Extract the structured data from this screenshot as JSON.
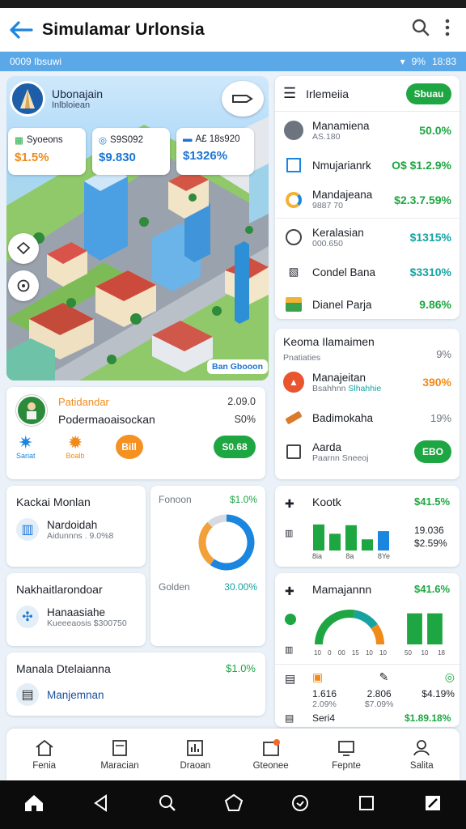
{
  "app_bar": {
    "title": "Simulamar Urlonsia"
  },
  "status_bar": {
    "left": "0009 Ibsuwi",
    "battery": "9%",
    "time": "18:83"
  },
  "map_panel": {
    "header_title": "Ubonajain",
    "header_subtitle": "Inlbloiean",
    "chips": [
      {
        "label": "Syoeons",
        "value": "$1.5%",
        "value_color": "#f08a19"
      },
      {
        "label": "S9S092",
        "value": "$9.830",
        "value_color": "#1a74d6"
      },
      {
        "label": "A£ 18s920",
        "value": "$1326%",
        "value_color": "#1a74d6"
      }
    ],
    "badge": "Ban Gbooon"
  },
  "right_list_top": {
    "title": "Irlemeiia",
    "action": "Sbuau",
    "rows": [
      {
        "label": "Manamiena",
        "sub": "AS.180",
        "value": "50.0%",
        "value_color": "#1ea642",
        "icon": "avatar-icon"
      },
      {
        "label": "Nmujarianrk",
        "sub": "",
        "value": "O$ $1.2.9%",
        "value_color": "#1ea642",
        "icon": "building-icon"
      },
      {
        "label": "Mandajeana",
        "sub": "9887 70",
        "value": "$2.3.7.59%",
        "value_color": "#1ea642",
        "icon": "chart-icon"
      }
    ]
  },
  "right_list_mid": {
    "rows": [
      {
        "label": "Keralasian",
        "sub": "000.650",
        "value": "$1315%",
        "value_color": "#14a3a3",
        "icon": "circle-icon"
      },
      {
        "label": "Condel Bana",
        "sub": "",
        "value": "$3310%",
        "value_color": "#14a3a3",
        "icon": "grid-icon"
      },
      {
        "label": "Dianel Parja",
        "sub": "",
        "value": "9.86%",
        "value_color": "#1ea642",
        "icon": "landscape-icon"
      }
    ]
  },
  "right_panel_kosma": {
    "title": "Keoma Ilamaimen",
    "subtitle": "Pnatiaties",
    "title_value": "9%",
    "rows": [
      {
        "label": "Manajeitan",
        "sub": "Bsahhnn",
        "sub2": "Slhahhie",
        "value": "390%",
        "value_color": "#f08a19",
        "icon": "flag-icon"
      },
      {
        "label": "Badimokaha",
        "sub": "",
        "value": "19%",
        "value_color": "#6d7480",
        "icon": "hammer-icon"
      },
      {
        "label": "Aarda",
        "sub": "Paarnn Sneeoj",
        "value": "EBO",
        "value_color": "#ffffff",
        "icon": "calendar-icon"
      }
    ]
  },
  "profile_card": {
    "title": "Patidandar",
    "subtitle": "Podermaoaisockan",
    "val1": "2.09.0",
    "val2": "S0%",
    "icon_label_1": "Sariat",
    "icon_label_2": "Boalb",
    "btn_orange": "Bill",
    "btn_green": "S0.68"
  },
  "left_cards": [
    {
      "title": "Kackai Monlan",
      "item_label": "Nardoidah",
      "item_sub": "Aidunnns . 9.0%8",
      "icon": "barrier-icon"
    },
    {
      "title": "Nakhaitlarondoar",
      "item_label": "Hanaasiahe",
      "item_sub": "Kueeeaosis $300750",
      "icon": "globe-icon"
    },
    {
      "title": "Manala Dtelaianna",
      "item_label": "Manjemnan",
      "item_sub": "",
      "value": "$1.0%",
      "icon": "layers-icon"
    }
  ],
  "donut_card": {
    "label": "Fonoon",
    "value": "$1.0%",
    "label2": "Golden",
    "value2": "30.00%"
  },
  "bar_card": {
    "title": "Kootk",
    "value": "$41.5%",
    "val_a": "19.036",
    "val_b": "$2.59%",
    "ticks": [
      "8ia",
      "8a",
      "8Ye"
    ]
  },
  "gauge_card": {
    "title": "Mamajannn",
    "value": "$41.6%",
    "ticks": [
      "10",
      "0",
      "00",
      "15",
      "10",
      "10"
    ],
    "ticks_right": [
      "50",
      "10",
      "18"
    ]
  },
  "stats_card": {
    "cols": [
      {
        "v1": "1.616",
        "v2": "2.09%"
      },
      {
        "v1": "2.806",
        "v2": "$7.09%"
      },
      {
        "v1": "$4.19%",
        "v2": ""
      }
    ],
    "foot_label": "Seri4",
    "foot_value": "$1.89.18%"
  },
  "bottom_nav": [
    "Fenia",
    "Maracian",
    "Draoan",
    "Gteonee",
    "Fepnte",
    "Salita"
  ],
  "chart_data": [
    {
      "type": "bar",
      "categories": [
        "8ia",
        "",
        "8a",
        "",
        "8Ye"
      ],
      "values": [
        70,
        45,
        68,
        30,
        52
      ],
      "title": "Kootk",
      "xlabel": "",
      "ylabel": "",
      "ylim": [
        0,
        100
      ]
    },
    {
      "type": "pie",
      "categories": [
        "blue",
        "orange",
        "grey"
      ],
      "values": [
        60,
        28,
        12
      ],
      "title": "",
      "xlabel": "",
      "ylabel": ""
    },
    {
      "type": "bar",
      "categories": [
        "",
        ""
      ],
      "values": [
        80,
        80
      ],
      "title": "",
      "xlabel": "",
      "ylabel": "",
      "ylim": [
        0,
        100
      ]
    }
  ]
}
